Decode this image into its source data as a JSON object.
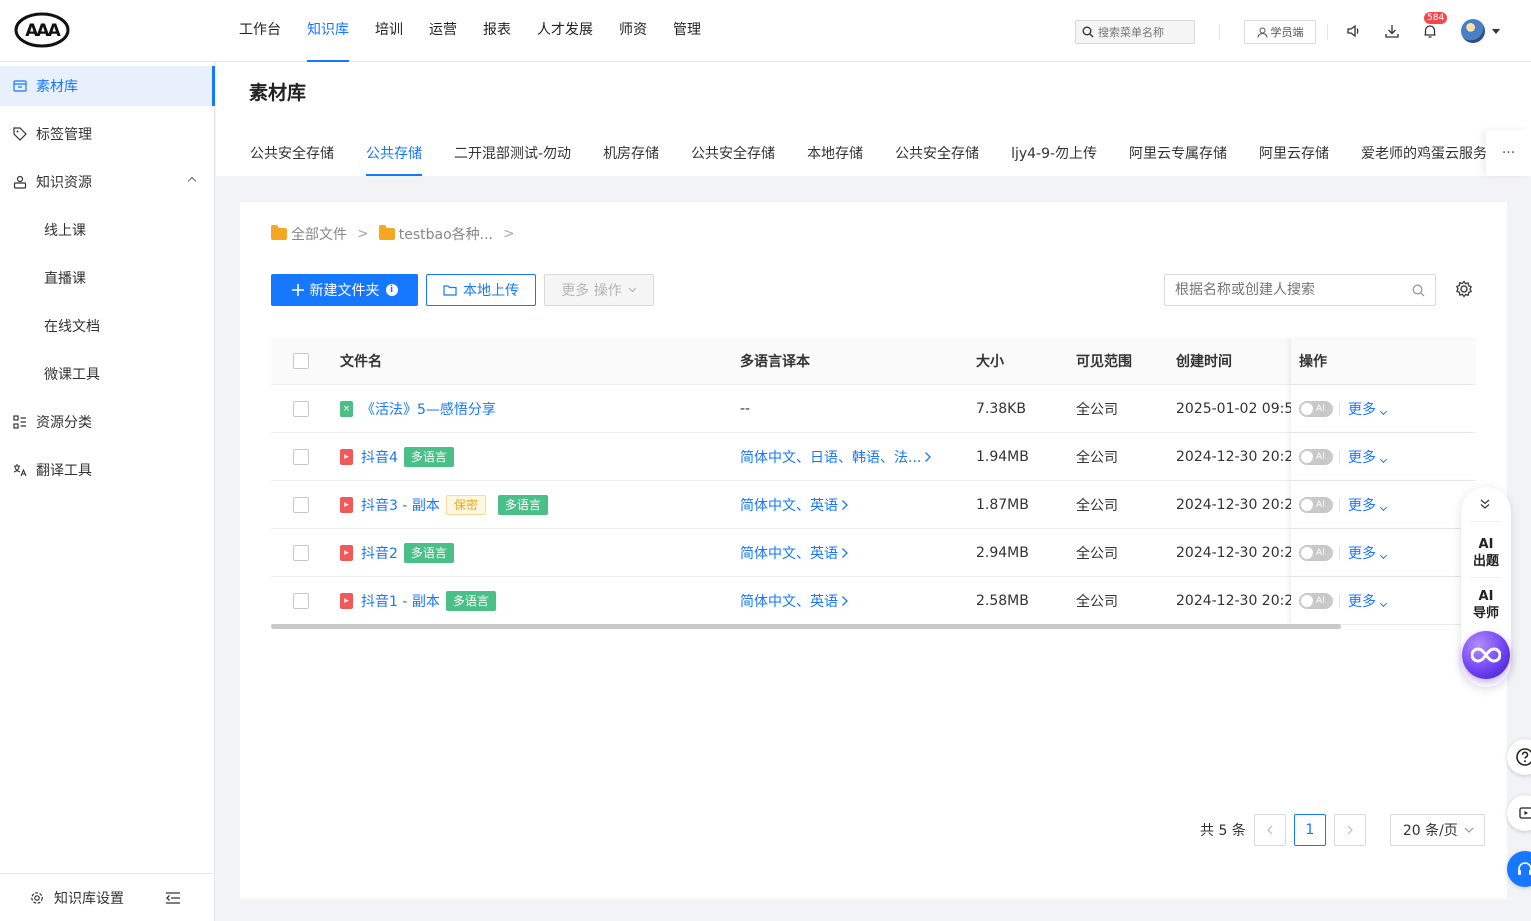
{
  "brand": {
    "logo_text": "AAA"
  },
  "nav": {
    "items": [
      {
        "label": "工作台"
      },
      {
        "label": "知识库",
        "active": true
      },
      {
        "label": "培训"
      },
      {
        "label": "运营"
      },
      {
        "label": "报表"
      },
      {
        "label": "人才发展"
      },
      {
        "label": "师资"
      },
      {
        "label": "管理"
      }
    ]
  },
  "header": {
    "menu_search_placeholder": "搜索菜单名称",
    "student_label": "学员端",
    "notification_count": "584",
    "icons": [
      "speaker-icon",
      "download-icon",
      "bell-icon",
      "avatar"
    ]
  },
  "sidebar": {
    "items": [
      {
        "label": "素材库",
        "icon": "archive-icon",
        "active": true
      },
      {
        "label": "标签管理",
        "icon": "tag-icon"
      },
      {
        "label": "知识资源",
        "icon": "resource-icon",
        "expanded": true
      },
      {
        "label": "线上课",
        "sub": true
      },
      {
        "label": "直播课",
        "sub": true
      },
      {
        "label": "在线文档",
        "sub": true
      },
      {
        "label": "微课工具",
        "sub": true
      },
      {
        "label": "资源分类",
        "icon": "category-icon"
      },
      {
        "label": "翻译工具",
        "icon": "translate-icon"
      }
    ],
    "footer_label": "知识库设置"
  },
  "page": {
    "title": "素材库",
    "storage_tabs": [
      "公共安全存储",
      "公共存储",
      "二开混部测试-勿动",
      "机房存储",
      "公共安全存储",
      "本地存储",
      "公共安全存储",
      "ljy4-9-勿上传",
      "阿里云专属存储",
      "阿里云存储",
      "爱老师的鸡蛋云服务"
    ],
    "active_tab_index": 1,
    "more_tabs": "···"
  },
  "breadcrumb": {
    "items": [
      "全部文件",
      "testbao各种..."
    ],
    "separator": ">"
  },
  "toolbar": {
    "new_folder_label": "新建文件夹",
    "upload_label": "本地上传",
    "more_ops_label": "更多 操作",
    "search_placeholder": "根据名称或创建人搜索"
  },
  "table": {
    "columns": [
      "文件名",
      "多语言译本",
      "大小",
      "可见范围",
      "创建时间",
      "操作"
    ],
    "rows": [
      {
        "name": "《活法》5—感悟分享",
        "file_type": "excel",
        "tags": [],
        "translations": "--",
        "translations_link": false,
        "size": "7.38KB",
        "scope": "全公司",
        "created": "2025-01-02 09:5",
        "ai": "AI",
        "more": "更多"
      },
      {
        "name": "抖音4",
        "file_type": "video",
        "tags": [
          {
            "text": "多语言",
            "style": "green"
          }
        ],
        "translations": "简体中文、日语、韩语、法...",
        "translations_link": true,
        "size": "1.94MB",
        "scope": "全公司",
        "created": "2024-12-30 20:2",
        "ai": "AI",
        "more": "更多"
      },
      {
        "name": "抖音3 - 副本",
        "file_type": "video",
        "tags": [
          {
            "text": "保密",
            "style": "yellow"
          },
          {
            "text": "多语言",
            "style": "green"
          }
        ],
        "translations": "简体中文、英语",
        "translations_link": true,
        "size": "1.87MB",
        "scope": "全公司",
        "created": "2024-12-30 20:2",
        "ai": "AI",
        "more": "更多"
      },
      {
        "name": "抖音2",
        "file_type": "video",
        "tags": [
          {
            "text": "多语言",
            "style": "green"
          }
        ],
        "translations": "简体中文、英语",
        "translations_link": true,
        "size": "2.94MB",
        "scope": "全公司",
        "created": "2024-12-30 20:2",
        "ai": "AI",
        "more": "更多"
      },
      {
        "name": "抖音1 - 副本",
        "file_type": "video",
        "tags": [
          {
            "text": "多语言",
            "style": "green"
          }
        ],
        "translations": "简体中文、英语",
        "translations_link": true,
        "size": "2.58MB",
        "scope": "全公司",
        "created": "2024-12-30 20:2",
        "ai": "AI",
        "more": "更多"
      }
    ]
  },
  "pagination": {
    "total_label": "共 5 条",
    "current_page": "1",
    "page_size_label": "20 条/页"
  },
  "ai_panel": {
    "item1_top": "AI",
    "item1_bottom": "出题",
    "item2_top": "AI",
    "item2_bottom": "导师"
  },
  "colors": {
    "primary": "#1677ff",
    "tag_green": "#4bbf88",
    "tag_yellow": "#f5a623",
    "badge_red": "#f5484d"
  }
}
